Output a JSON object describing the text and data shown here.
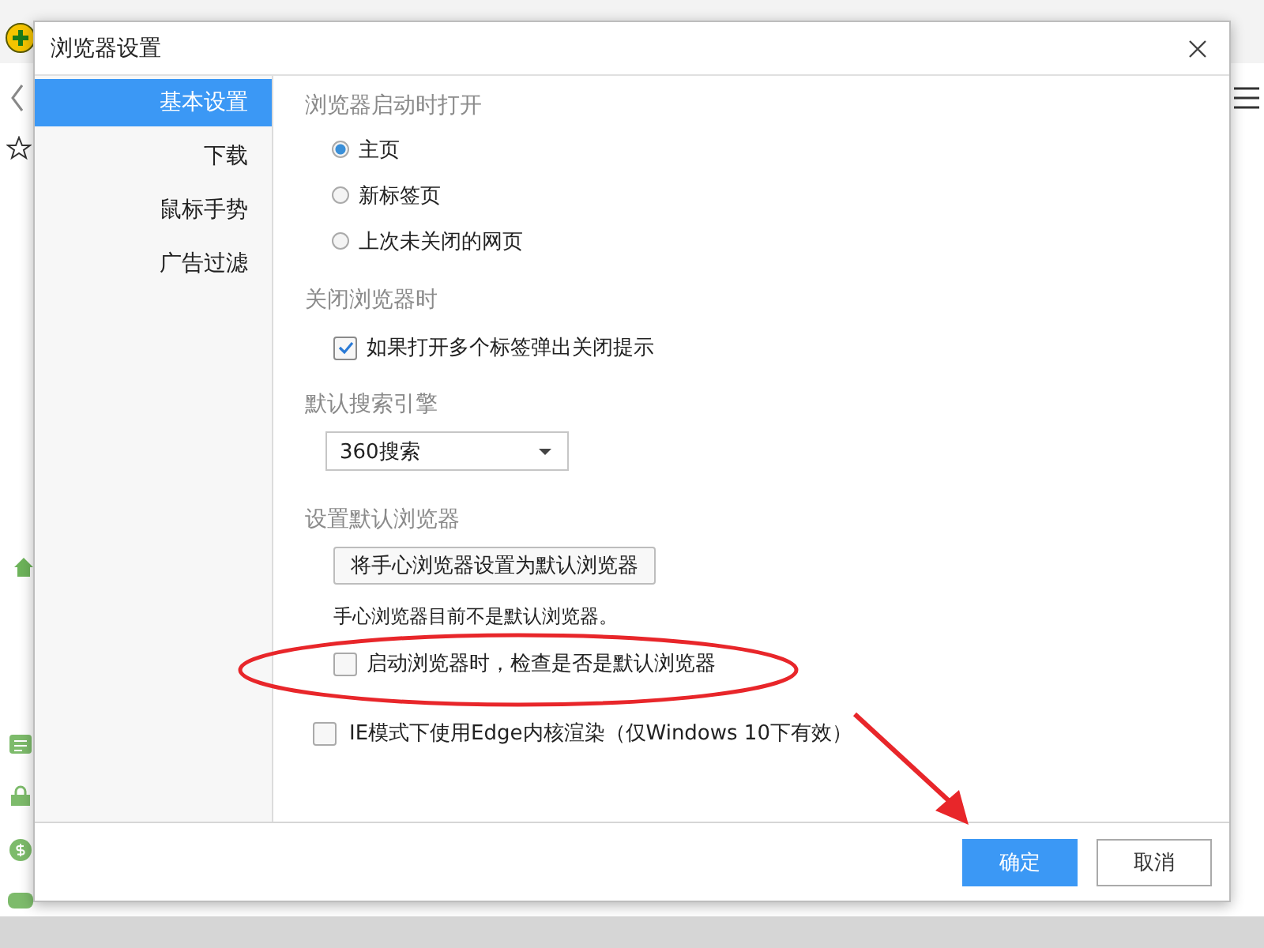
{
  "dialog": {
    "title": "浏览器设置",
    "sidebar": {
      "items": [
        {
          "label": "基本设置",
          "selected": true
        },
        {
          "label": "下载",
          "selected": false
        },
        {
          "label": "鼠标手势",
          "selected": false
        },
        {
          "label": "广告过滤",
          "selected": false
        }
      ]
    },
    "sections": [
      {
        "heading": "浏览器启动时打开",
        "controls": [
          {
            "kind": "radio",
            "label": "主页",
            "checked": true
          },
          {
            "kind": "radio",
            "label": "新标签页",
            "checked": false
          },
          {
            "kind": "radio",
            "label": "上次未关闭的网页",
            "checked": false
          }
        ]
      },
      {
        "heading": "关闭浏览器时",
        "controls": [
          {
            "kind": "checkbox",
            "label": "如果打开多个标签弹出关闭提示",
            "checked": true
          }
        ]
      },
      {
        "heading": "默认搜索引擎",
        "controls": [
          {
            "kind": "select",
            "value": "360搜索"
          }
        ]
      },
      {
        "heading": "设置默认浏览器",
        "controls": [
          {
            "kind": "button",
            "label": "将手心浏览器设置为默认浏览器"
          },
          {
            "kind": "note",
            "text": "手心浏览器目前不是默认浏览器。"
          },
          {
            "kind": "checkbox",
            "label": "启动浏览器时，检查是否是默认浏览器",
            "checked": false
          }
        ]
      }
    ],
    "extra_options": [
      {
        "kind": "checkbox",
        "label": "IE模式下使用Edge内核渲染（仅Windows 10下有效）",
        "checked": false
      }
    ],
    "buttons": [
      {
        "label": "确定",
        "kind": "primary"
      },
      {
        "label": "取消",
        "kind": "secondary"
      }
    ]
  }
}
